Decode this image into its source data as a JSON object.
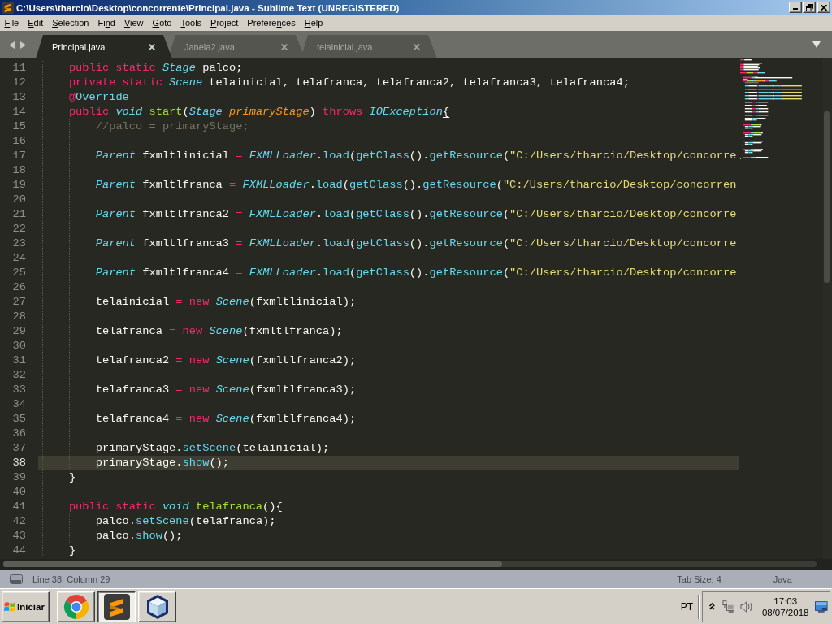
{
  "window": {
    "title": "C:\\Users\\tharcio\\Desktop\\concorrente\\Principal.java - Sublime Text (UNREGISTERED)"
  },
  "menu": [
    {
      "key": "F",
      "tail": "ile"
    },
    {
      "key": "E",
      "tail": "dit"
    },
    {
      "key": "S",
      "tail": "election"
    },
    {
      "head": "Fi",
      "key": "n",
      "tail": "d"
    },
    {
      "key": "V",
      "tail": "iew"
    },
    {
      "key": "G",
      "tail": "oto"
    },
    {
      "key": "T",
      "tail": "ools"
    },
    {
      "key": "P",
      "tail": "roject"
    },
    {
      "head": "Prefere",
      "key": "n",
      "tail": "ces"
    },
    {
      "key": "H",
      "tail": "elp"
    }
  ],
  "tabs": [
    {
      "label": "Principal.java",
      "selected": true
    },
    {
      "label": "Janela2.java",
      "selected": false
    },
    {
      "label": "telainicial.java",
      "selected": false
    }
  ],
  "editor": {
    "lines": [
      {
        "number": "11",
        "current": false,
        "tokens": [
          {
            "kind": "keyword",
            "text": "public static "
          },
          {
            "kind": "type",
            "text": "Stage"
          },
          {
            "kind": "plain",
            "text": " palco;"
          }
        ]
      },
      {
        "number": "12",
        "current": false,
        "tokens": [
          {
            "kind": "keyword",
            "text": "private static "
          },
          {
            "kind": "type",
            "text": "Scene"
          },
          {
            "kind": "plain",
            "text": " telainicial, telafranca, telafranca2, telafranca3, telafranca4;"
          }
        ]
      },
      {
        "number": "13",
        "current": false,
        "tokens": [
          {
            "kind": "keyword",
            "text": "@"
          },
          {
            "kind": "call",
            "text": "Override"
          }
        ]
      },
      {
        "number": "14",
        "current": false,
        "tokens": [
          {
            "kind": "keyword",
            "text": "public "
          },
          {
            "kind": "type",
            "text": "void"
          },
          {
            "kind": "func",
            "text": " start"
          },
          {
            "kind": "plain",
            "text": "("
          },
          {
            "kind": "type",
            "text": "Stage"
          },
          {
            "kind": "param",
            "text": " primaryStage"
          },
          {
            "kind": "plain",
            "text": ") "
          },
          {
            "kind": "keyword",
            "text": "throws "
          },
          {
            "kind": "type",
            "text": "IOException"
          },
          {
            "kind": "match",
            "text": "{"
          }
        ],
        "children": [
          {
            "number": "15",
            "current": false,
            "tokens": [
              {
                "kind": "comment",
                "text": "//palco = primaryStage;"
              }
            ]
          },
          {
            "number": "16",
            "current": false
          },
          {
            "number": "17",
            "current": false,
            "tokens": [
              {
                "kind": "type",
                "text": "Parent"
              },
              {
                "kind": "plain",
                "text": " fxmltlinicial "
              },
              {
                "kind": "keyword",
                "text": "= "
              },
              {
                "kind": "type",
                "text": "FXMLLoader"
              },
              {
                "kind": "plain",
                "text": "."
              },
              {
                "kind": "call",
                "text": "load"
              },
              {
                "kind": "plain",
                "text": "("
              },
              {
                "kind": "call",
                "text": "getClass"
              },
              {
                "kind": "plain",
                "text": "()."
              },
              {
                "kind": "call",
                "text": "getResource"
              },
              {
                "kind": "plain",
                "text": "("
              },
              {
                "kind": "string",
                "text": "\"C:/Users/tharcio/Desktop/concorre"
              }
            ]
          },
          {
            "number": "18",
            "current": false
          },
          {
            "number": "19",
            "current": false,
            "tokens": [
              {
                "kind": "type",
                "text": "Parent"
              },
              {
                "kind": "plain",
                "text": " fxmltlfranca "
              },
              {
                "kind": "keyword",
                "text": "= "
              },
              {
                "kind": "type",
                "text": "FXMLLoader"
              },
              {
                "kind": "plain",
                "text": "."
              },
              {
                "kind": "call",
                "text": "load"
              },
              {
                "kind": "plain",
                "text": "("
              },
              {
                "kind": "call",
                "text": "getClass"
              },
              {
                "kind": "plain",
                "text": "()."
              },
              {
                "kind": "call",
                "text": "getResource"
              },
              {
                "kind": "plain",
                "text": "("
              },
              {
                "kind": "string",
                "text": "\"C:/Users/tharcio/Desktop/concorren"
              }
            ]
          },
          {
            "number": "20",
            "current": false
          },
          {
            "number": "21",
            "current": false,
            "tokens": [
              {
                "kind": "type",
                "text": "Parent"
              },
              {
                "kind": "plain",
                "text": " fxmltlfranca2 "
              },
              {
                "kind": "keyword",
                "text": "= "
              },
              {
                "kind": "type",
                "text": "FXMLLoader"
              },
              {
                "kind": "plain",
                "text": "."
              },
              {
                "kind": "call",
                "text": "load"
              },
              {
                "kind": "plain",
                "text": "("
              },
              {
                "kind": "call",
                "text": "getClass"
              },
              {
                "kind": "plain",
                "text": "()."
              },
              {
                "kind": "call",
                "text": "getResource"
              },
              {
                "kind": "plain",
                "text": "("
              },
              {
                "kind": "string",
                "text": "\"C:/Users/tharcio/Desktop/concorre"
              }
            ]
          },
          {
            "number": "22",
            "current": false
          },
          {
            "number": "23",
            "current": false,
            "tokens": [
              {
                "kind": "type",
                "text": "Parent"
              },
              {
                "kind": "plain",
                "text": " fxmltlfranca3 "
              },
              {
                "kind": "keyword",
                "text": "= "
              },
              {
                "kind": "type",
                "text": "FXMLLoader"
              },
              {
                "kind": "plain",
                "text": "."
              },
              {
                "kind": "call",
                "text": "load"
              },
              {
                "kind": "plain",
                "text": "("
              },
              {
                "kind": "call",
                "text": "getClass"
              },
              {
                "kind": "plain",
                "text": "()."
              },
              {
                "kind": "call",
                "text": "getResource"
              },
              {
                "kind": "plain",
                "text": "("
              },
              {
                "kind": "string",
                "text": "\"C:/Users/tharcio/Desktop/concorre"
              }
            ]
          },
          {
            "number": "24",
            "current": false
          },
          {
            "number": "25",
            "current": false,
            "tokens": [
              {
                "kind": "type",
                "text": "Parent"
              },
              {
                "kind": "plain",
                "text": " fxmltlfranca4 "
              },
              {
                "kind": "keyword",
                "text": "= "
              },
              {
                "kind": "type",
                "text": "FXMLLoader"
              },
              {
                "kind": "plain",
                "text": "."
              },
              {
                "kind": "call",
                "text": "load"
              },
              {
                "kind": "plain",
                "text": "("
              },
              {
                "kind": "call",
                "text": "getClass"
              },
              {
                "kind": "plain",
                "text": "()."
              },
              {
                "kind": "call",
                "text": "getResource"
              },
              {
                "kind": "plain",
                "text": "("
              },
              {
                "kind": "string",
                "text": "\"C:/Users/tharcio/Desktop/concorre"
              }
            ]
          },
          {
            "number": "26",
            "current": false
          },
          {
            "number": "27",
            "current": false,
            "tokens": [
              {
                "kind": "plain",
                "text": "telainicial "
              },
              {
                "kind": "keyword",
                "text": "= new "
              },
              {
                "kind": "type",
                "text": "Scene"
              },
              {
                "kind": "plain",
                "text": "(fxmltlinicial);"
              }
            ]
          },
          {
            "number": "28",
            "current": false
          },
          {
            "number": "29",
            "current": false,
            "tokens": [
              {
                "kind": "plain",
                "text": "telafranca "
              },
              {
                "kind": "keyword",
                "text": "= new "
              },
              {
                "kind": "type",
                "text": "Scene"
              },
              {
                "kind": "plain",
                "text": "(fxmltlfranca);"
              }
            ]
          },
          {
            "number": "30",
            "current": false
          },
          {
            "number": "31",
            "current": false,
            "tokens": [
              {
                "kind": "plain",
                "text": "telafranca2 "
              },
              {
                "kind": "keyword",
                "text": "= new "
              },
              {
                "kind": "type",
                "text": "Scene"
              },
              {
                "kind": "plain",
                "text": "(fxmltlfranca2);"
              }
            ]
          },
          {
            "number": "32",
            "current": false
          },
          {
            "number": "33",
            "current": false,
            "tokens": [
              {
                "kind": "plain",
                "text": "telafranca3 "
              },
              {
                "kind": "keyword",
                "text": "= new "
              },
              {
                "kind": "type",
                "text": "Scene"
              },
              {
                "kind": "plain",
                "text": "(fxmltlfranca3);"
              }
            ]
          },
          {
            "number": "34",
            "current": false
          },
          {
            "number": "35",
            "current": false,
            "tokens": [
              {
                "kind": "plain",
                "text": "telafranca4 "
              },
              {
                "kind": "keyword",
                "text": "= new "
              },
              {
                "kind": "type",
                "text": "Scene"
              },
              {
                "kind": "plain",
                "text": "(fxmltlfranca4);"
              }
            ]
          },
          {
            "number": "36",
            "current": false
          },
          {
            "number": "37",
            "current": false,
            "tokens": [
              {
                "kind": "plain",
                "text": "primaryStage."
              },
              {
                "kind": "call",
                "text": "setScene"
              },
              {
                "kind": "plain",
                "text": "(telainicial);"
              }
            ]
          },
          {
            "number": "38",
            "current": true,
            "tokens": [
              {
                "kind": "plain",
                "text": "primaryStage."
              },
              {
                "kind": "call",
                "text": "show"
              },
              {
                "kind": "plain",
                "text": "();"
              }
            ]
          }
        ]
      },
      {
        "number": "39",
        "current": false,
        "tokens": [
          {
            "kind": "match",
            "text": "}"
          }
        ]
      },
      {
        "number": "40",
        "current": false
      },
      {
        "number": "41",
        "current": false,
        "tokens": [
          {
            "kind": "keyword",
            "text": "public static "
          },
          {
            "kind": "type",
            "text": "void"
          },
          {
            "kind": "func",
            "text": " telafranca"
          },
          {
            "kind": "plain",
            "text": "(){"
          }
        ],
        "children": [
          {
            "number": "42",
            "current": false,
            "tokens": [
              {
                "kind": "plain",
                "text": "palco."
              },
              {
                "kind": "call",
                "text": "setScene"
              },
              {
                "kind": "plain",
                "text": "(telafranca);"
              }
            ]
          },
          {
            "number": "43",
            "current": false,
            "tokens": [
              {
                "kind": "plain",
                "text": "palco."
              },
              {
                "kind": "call",
                "text": "show"
              },
              {
                "kind": "plain",
                "text": "();"
              }
            ]
          }
        ]
      },
      {
        "number": "44",
        "current": false,
        "tokens": [
          {
            "kind": "plain",
            "text": "}"
          }
        ]
      }
    ]
  },
  "status_bar": {
    "position": "Line 38, Column 29",
    "tab_size": "Tab Size: 4",
    "syntax": "Java"
  },
  "taskbar": {
    "start_label": "Iniciar",
    "apps": [
      {
        "kind": "browser",
        "selected": false
      },
      {
        "kind": "editor",
        "selected": true
      },
      {
        "kind": "ide",
        "selected": false
      }
    ],
    "language": "PT",
    "time": "17:03",
    "date": "08/07/2018"
  }
}
